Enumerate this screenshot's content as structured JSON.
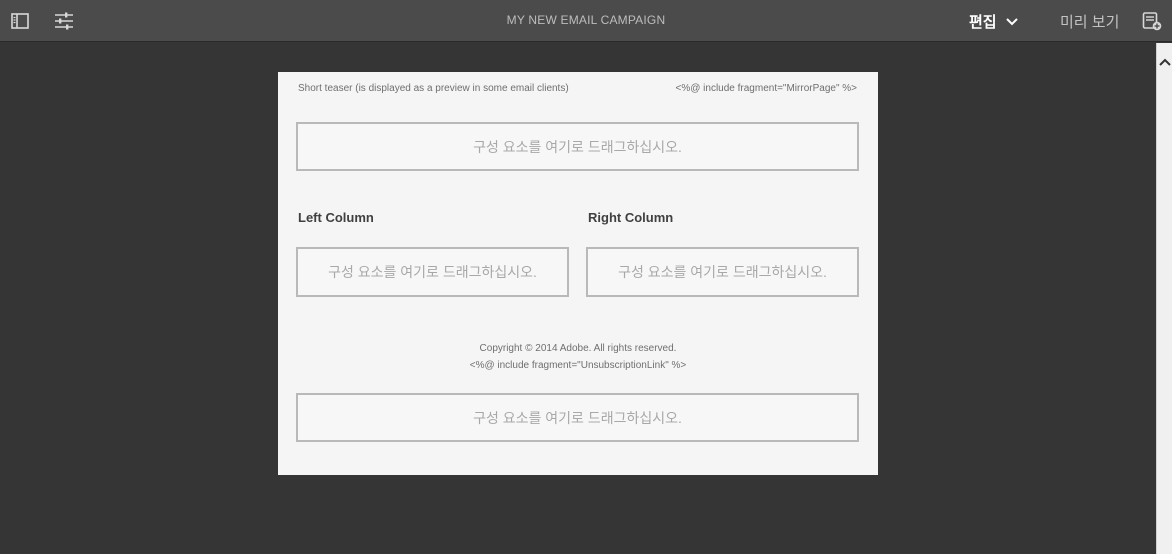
{
  "header": {
    "title": "MY NEW EMAIL CAMPAIGN",
    "edit_label": "편집",
    "preview_label": "미리 보기"
  },
  "icons": {
    "sidebar": "sidebar-toggle-icon",
    "properties": "sliders-icon",
    "chevron": "chevron-down-icon",
    "annotate": "annotate-icon",
    "scroll": "chevron-up-icon"
  },
  "email": {
    "teaser": "Short teaser (is displayed as a preview in some email clients)",
    "mirror_fragment": "<%@ include fragment=\"MirrorPage\" %>",
    "dropzone_top": "구성 요소를 여기로 드래그하십시오.",
    "left_column_title": "Left Column",
    "right_column_title": "Right Column",
    "dropzone_left": "구성 요소를 여기로 드래그하십시오.",
    "dropzone_right": "구성 요소를 여기로 드래그하십시오.",
    "copyright": "Copyright © 2014 Adobe. All rights reserved.",
    "unsubscribe_fragment": "<%@ include fragment=\"UnsubscriptionLink\" %>",
    "dropzone_bottom": "구성 요소를 여기로 드래그하십시오."
  },
  "colors": {
    "topbar": "#4b4b4b",
    "workspace": "#353535",
    "canvas": "#f5f5f5",
    "dropzone_border": "#b9b9b9"
  }
}
